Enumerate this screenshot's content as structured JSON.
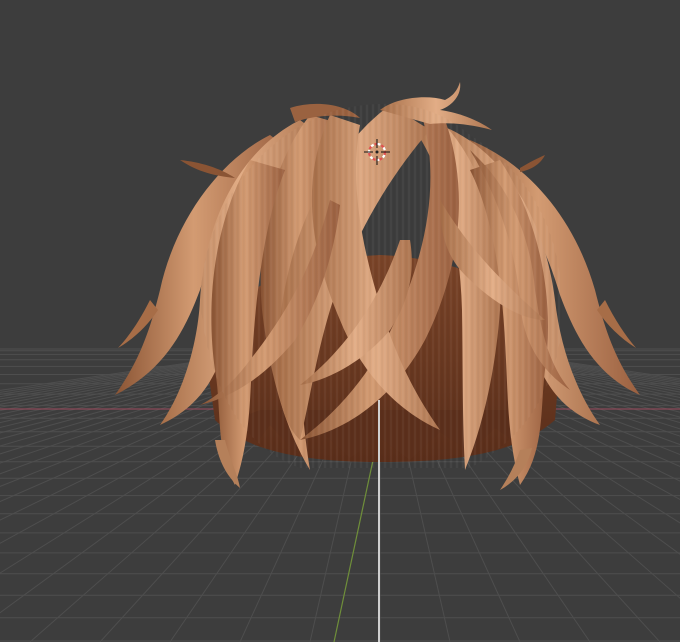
{
  "viewport": {
    "kind": "3D viewport",
    "background_color": "#3d3d3d",
    "grid_color": "#4e4e4e",
    "x_axis_color": "#8a4a58",
    "y_axis_color": "#6f8f3a",
    "z_axis_color": "#cfcfcf",
    "cursor_3d_colors": [
      "#e05050",
      "#ffffff"
    ],
    "object": {
      "name": "hair mesh",
      "base_color": "#b07a55",
      "highlight_color": "#dba47c",
      "shadow_color": "#6a3b22"
    }
  }
}
